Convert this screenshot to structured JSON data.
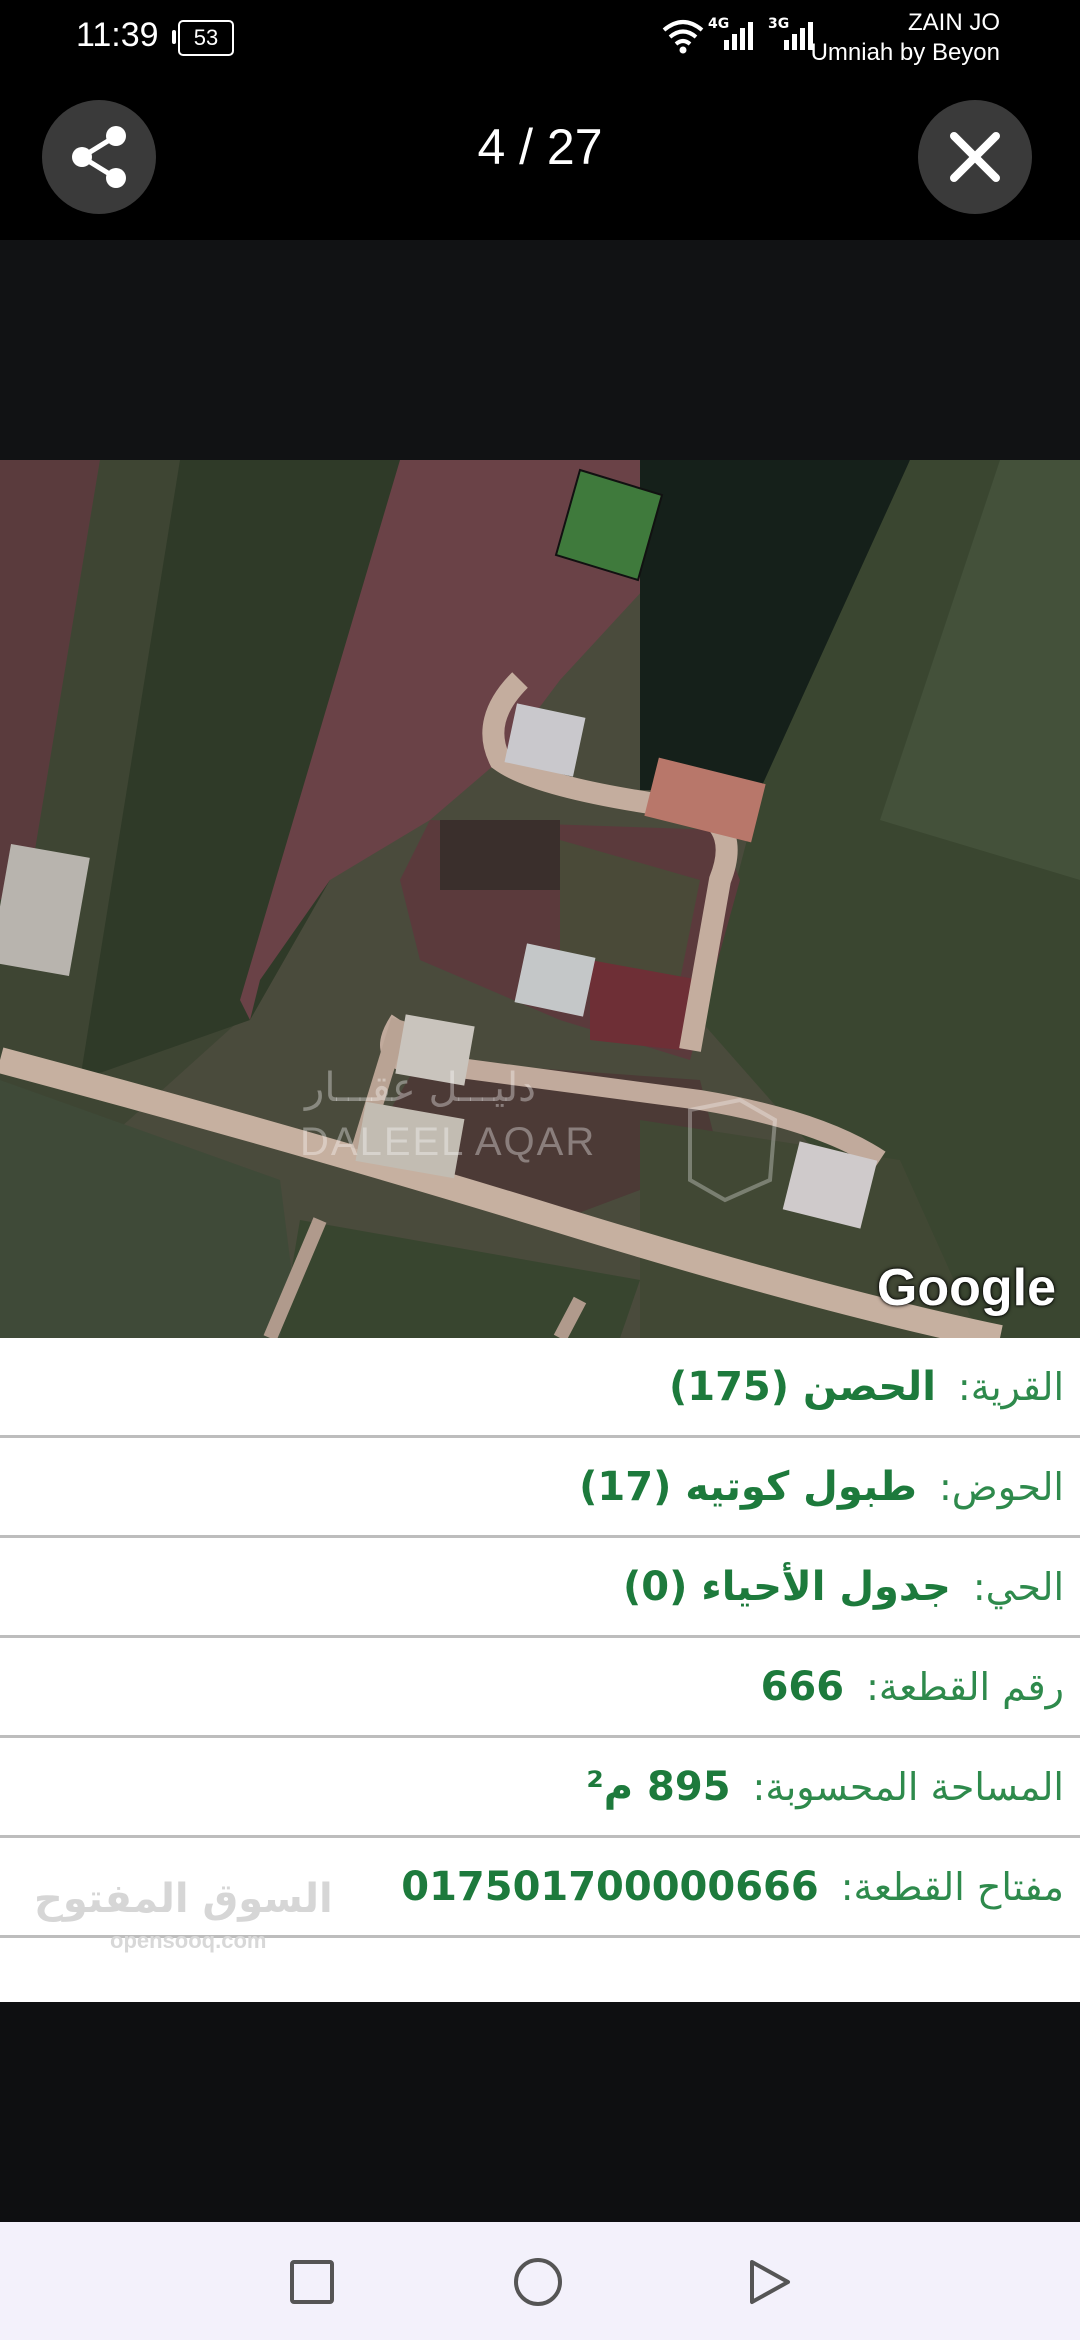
{
  "status_bar": {
    "time": "11:39",
    "battery": "53",
    "net1": "4G",
    "net2": "3G",
    "carrier_line1": "ZAIN JO",
    "carrier_line2": "Umniah by Beyon"
  },
  "header": {
    "counter": "4 / 27"
  },
  "map": {
    "google_label": "Google",
    "watermark_ar": "دليـــل عقـــار",
    "watermark_en": "DALEEL AQAR"
  },
  "info": {
    "rows": [
      {
        "label": "القرية:",
        "value": "الحصن (175)"
      },
      {
        "label": "الحوض:",
        "value": "طبول كوتيه (17)"
      },
      {
        "label": "الحي:",
        "value": "جدول الأحياء (0)"
      },
      {
        "label": "رقم القطعة:",
        "value": "666"
      },
      {
        "label": "المساحة المحسوبة:",
        "value": "895 م²"
      },
      {
        "label": "مفتاح القطعة:",
        "value": "017501700000666"
      }
    ],
    "opensooq_ar": "السوق المفتوح",
    "opensooq_en": "opensooq.com"
  },
  "colors": {
    "accent_green": "#2e8a4c",
    "parcel_fill": "#3f7a3c"
  }
}
